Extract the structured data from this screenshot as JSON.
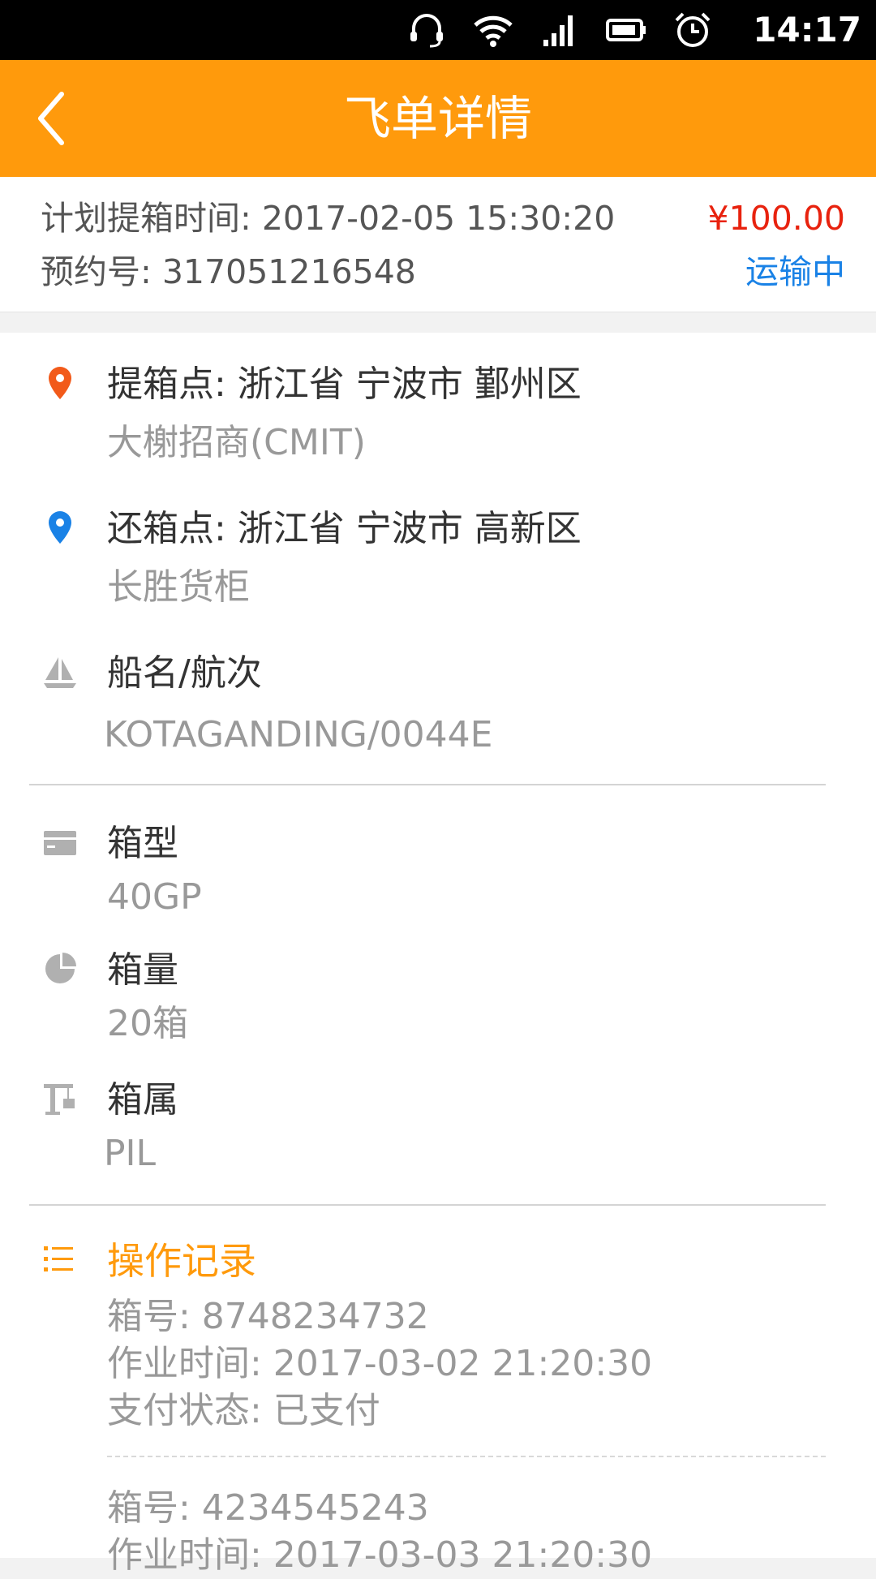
{
  "status_bar": {
    "time": "14:17",
    "icons": [
      "headset-icon",
      "wifi-icon",
      "signal-icon",
      "battery-icon",
      "alarm-icon"
    ]
  },
  "header": {
    "title": "飞单详情",
    "back_icon": "chevron-left-icon"
  },
  "summary": {
    "plan_pickup_time": "计划提箱时间: 2017-02-05  15:30:20",
    "booking_no": "预约号: 317051216548",
    "price": "¥100.00",
    "status": "运输中"
  },
  "details": {
    "pickup": {
      "label": "提箱点: 浙江省 宁波市 鄞州区",
      "value": "大榭招商(CMIT)"
    },
    "return": {
      "label": "还箱点: 浙江省 宁波市 高新区",
      "value": "长胜货柜"
    },
    "vessel": {
      "label": "船名/航次",
      "value": "KOTAGANDING/0044E"
    },
    "box_type": {
      "label": "箱型",
      "value": "40GP"
    },
    "box_qty": {
      "label": "箱量",
      "value": "20箱"
    },
    "box_owner": {
      "label": "箱属",
      "value": "PIL"
    }
  },
  "operations": {
    "title": "操作记录",
    "records": [
      {
        "box_no": "箱号: 8748234732",
        "op_time": "作业时间: 2017-03-02  21:20:30",
        "pay_status": "支付状态: 已支付"
      },
      {
        "box_no": "箱号: 4234545243",
        "op_time": "作业时间: 2017-03-03  21:20:30"
      }
    ]
  },
  "colors": {
    "accent": "#ff9a0c",
    "price": "#e8220e",
    "status": "#1a82e6",
    "pickup_pin": "#f25a1a",
    "return_pin": "#1a82e6"
  }
}
